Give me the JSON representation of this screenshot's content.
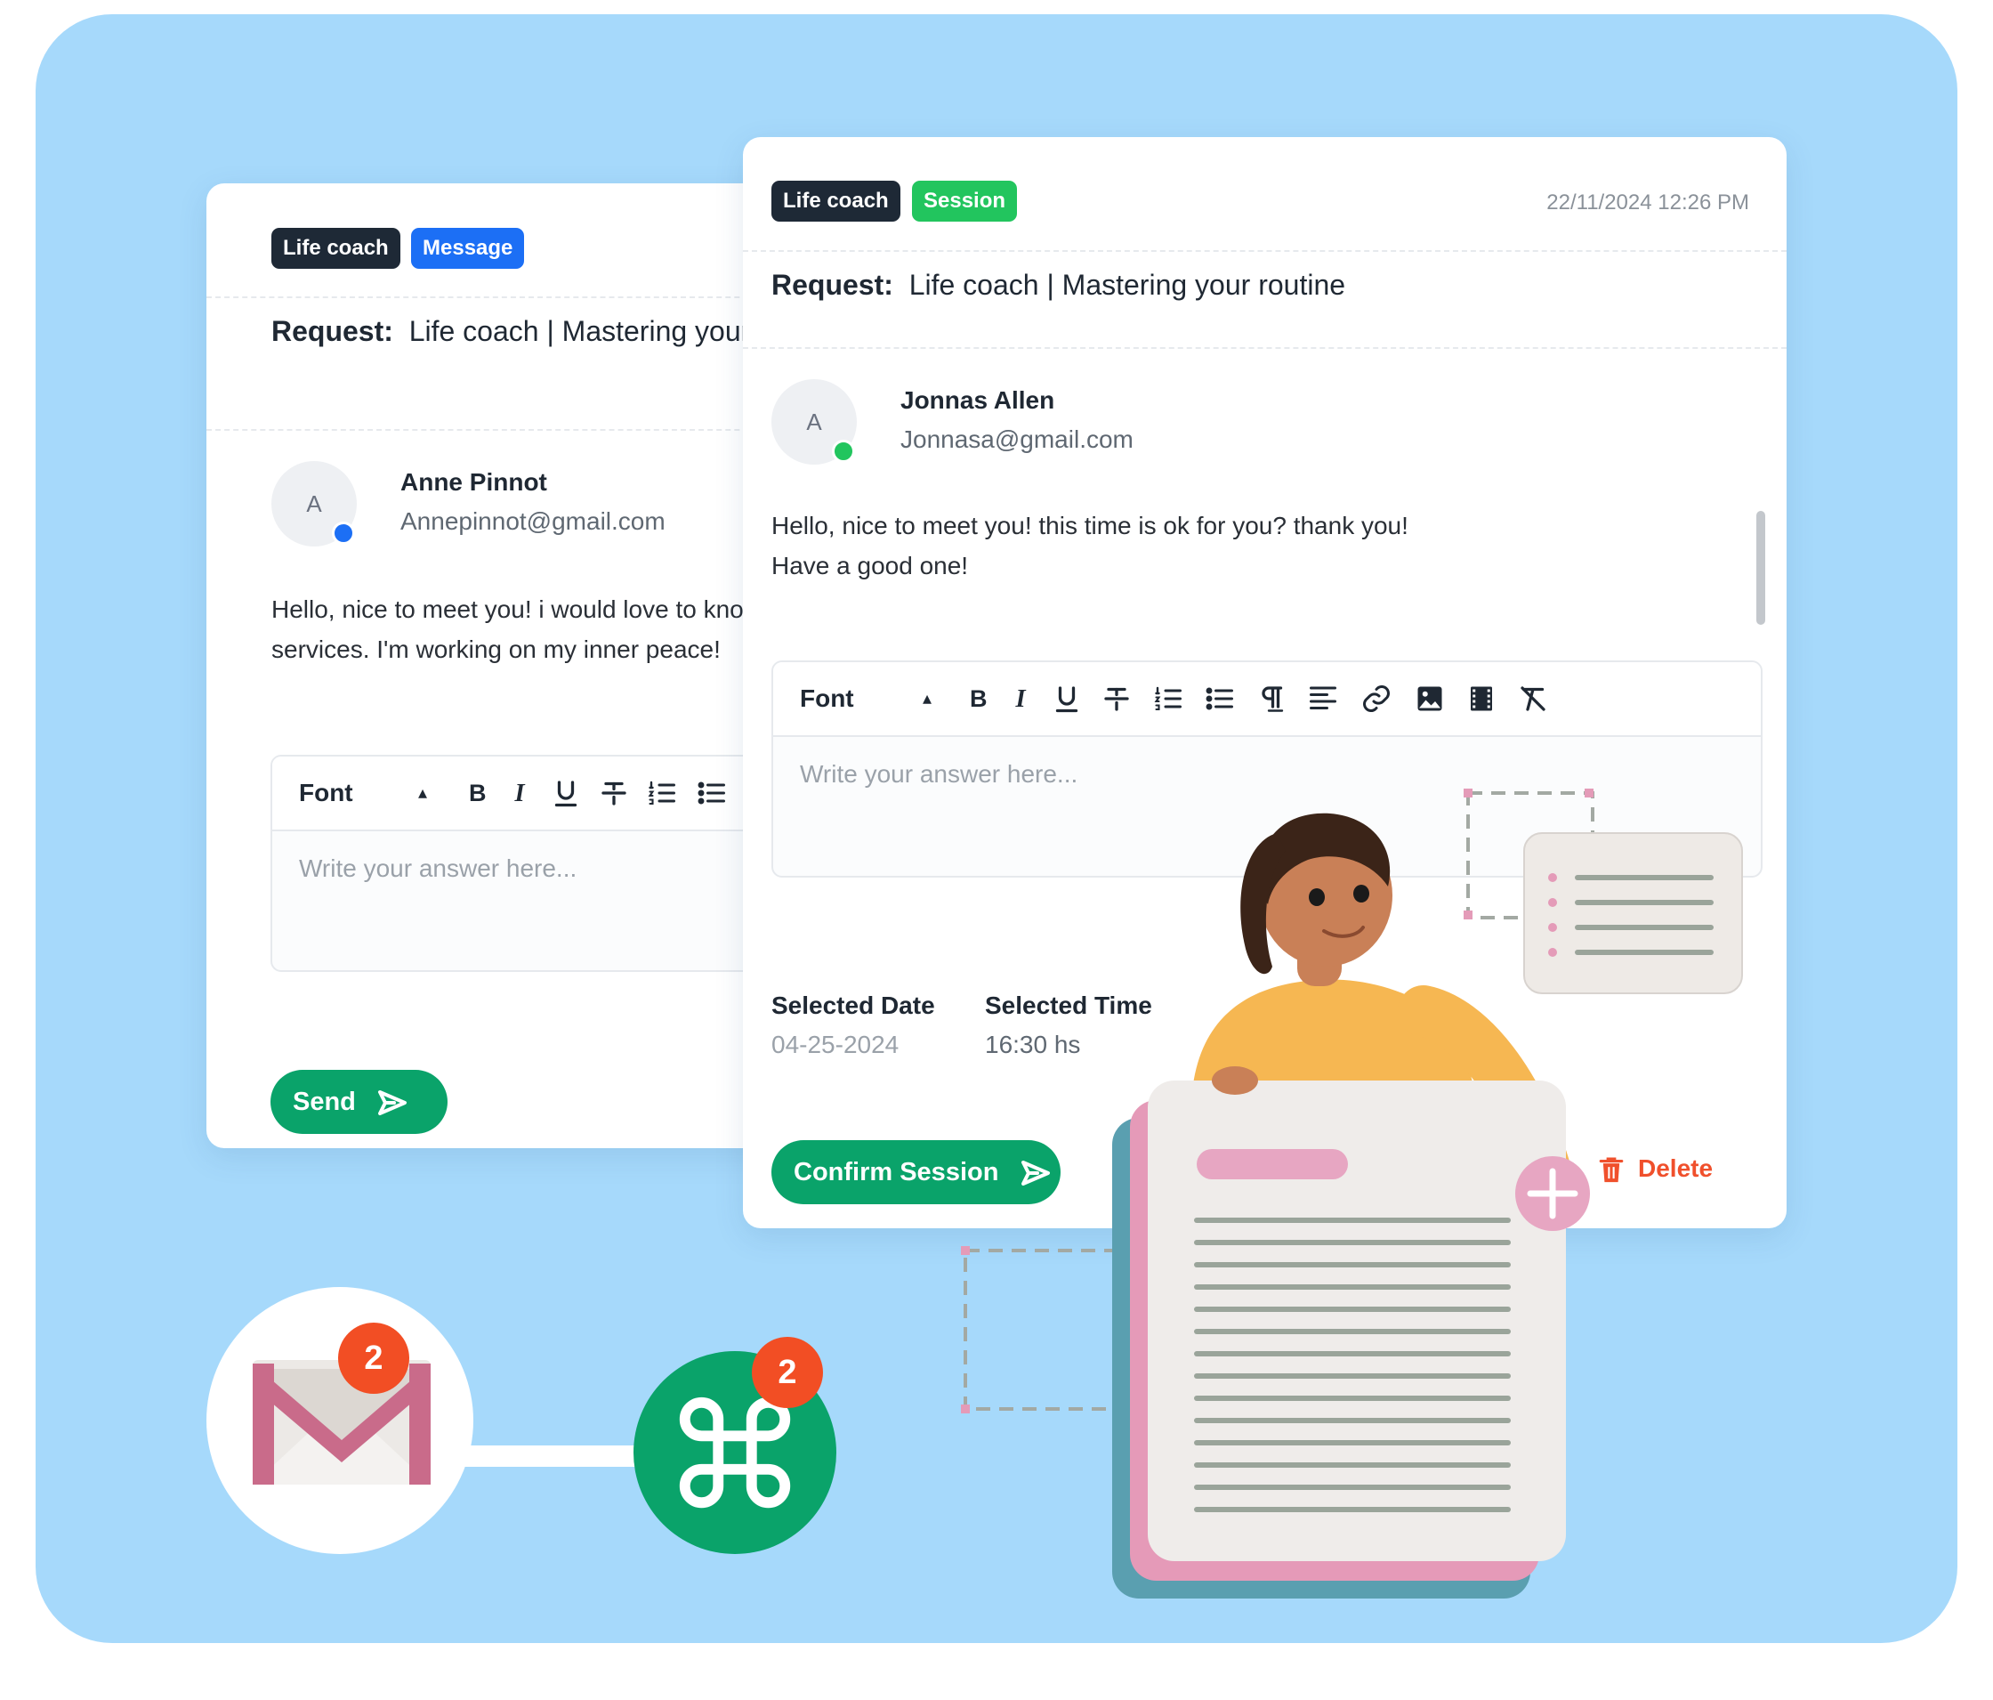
{
  "card_message": {
    "tags": [
      "Life coach",
      "Message"
    ],
    "request_label": "Request:",
    "request_title": "Life coach | Mastering your routine",
    "avatar_initial": "A",
    "sender_name": "Anne Pinnot",
    "sender_email": "Annepinnot@gmail.com",
    "message_lines": [
      "Hello, nice to meet you! i would love to know more about your",
      "services. I'm working on my inner peace!"
    ],
    "editor": {
      "font_label": "Font",
      "placeholder": "Write your answer here..."
    },
    "send_label": "Send"
  },
  "card_session": {
    "tags": [
      "Life coach",
      "Session"
    ],
    "timestamp": "22/11/2024 12:26 PM",
    "request_label": "Request:",
    "request_title": "Life coach | Mastering your routine",
    "avatar_initial": "A",
    "sender_name": "Jonnas Allen",
    "sender_email": "Jonnasa@gmail.com",
    "message_lines": [
      "Hello, nice to meet you! this time is ok for you? thank you!",
      "Have a good one!"
    ],
    "editor": {
      "font_label": "Font",
      "placeholder": "Write your answer here..."
    },
    "selected_date_label": "Selected Date",
    "selected_date": "04-25-2024",
    "selected_time_label": "Selected Time",
    "selected_time": "16:30 hs",
    "confirm_label": "Confirm Session",
    "delete_label": "Delete"
  },
  "integrations": {
    "gmail_badge": "2",
    "command_badge": "2",
    "gmail_icon": "gmail-envelope-icon",
    "command_icon": "command-key-icon"
  },
  "toolbar_icons": [
    "bold-icon",
    "italic-icon",
    "underline-icon",
    "strikethrough-icon",
    "ordered-list-icon",
    "bullet-list-icon",
    "paragraph-icon",
    "align-icon",
    "link-icon",
    "image-icon",
    "video-icon",
    "clear-format-icon"
  ],
  "colors": {
    "background": "#a6d9fb",
    "tag_dark": "#1e2936",
    "tag_message": "#1c6ff5",
    "tag_session": "#22c55e",
    "primary_button": "#0aa36a",
    "delete": "#f0502c",
    "online_dot": "#22c55e",
    "message_dot": "#1c6ff5",
    "badge": "#f24e24"
  }
}
